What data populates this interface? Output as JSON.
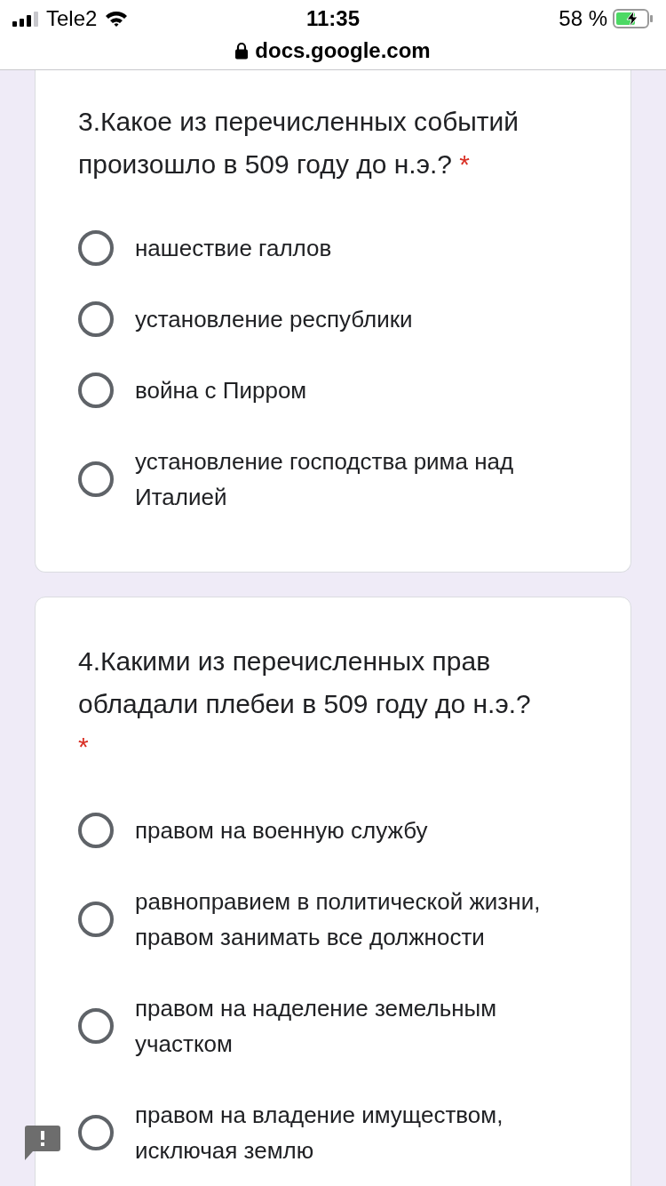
{
  "status_bar": {
    "carrier": "Tele2",
    "time": "11:35",
    "battery": "58 %"
  },
  "address_bar": {
    "url": "docs.google.com"
  },
  "questions": [
    {
      "text": "3.Какое из перечисленных событий произошло в 509 году до н.э.?",
      "required_mark": "*",
      "options": [
        {
          "label": "нашествие галлов",
          "selected": false
        },
        {
          "label": "установление республики",
          "selected": false
        },
        {
          "label": "война с Пирром",
          "selected": false
        },
        {
          "label": "установление господства рима над Италией",
          "selected": false
        }
      ]
    },
    {
      "text": "4.Какими из перечисленных прав обладали плебеи в 509 году до н.э.?",
      "required_mark": "*",
      "options": [
        {
          "label": "правом на военную службу",
          "selected": false
        },
        {
          "label": "равноправием в политической жизни, правом занимать все должности",
          "selected": false
        },
        {
          "label": "правом на наделение земельным участком",
          "selected": false
        },
        {
          "label": "правом на владение имуществом, исключая землю",
          "selected": false
        }
      ]
    }
  ]
}
